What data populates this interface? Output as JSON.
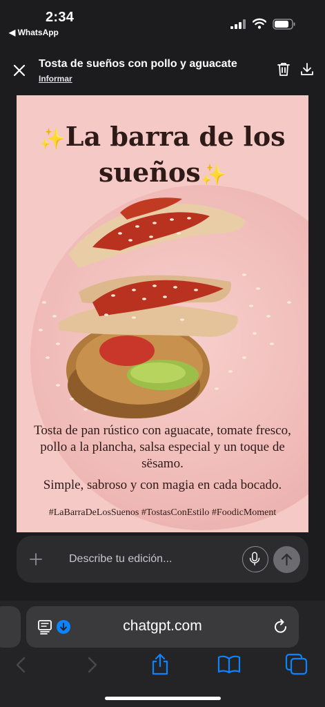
{
  "status_bar": {
    "time": "2:34",
    "back_app": "◀ WhatsApp"
  },
  "header": {
    "title": "Tosta de sueños con pollo y aguacate",
    "report_link": "Informar"
  },
  "poster": {
    "title_line1": "La barra de los",
    "title_line2": "sueños",
    "description": "Tosta de pan rústico con aguacate, tomate fresco, pollo a la plancha, salsa especial y un toque de sësamo.",
    "tagline": "Simple, sabroso y con magia en cada bocado.",
    "hashtags": "#LaBarraDeLosSuenos #TostasConEstilo #FoodicMoment",
    "sparkle": "✨"
  },
  "composer": {
    "placeholder": "Describe tu edición..."
  },
  "browser": {
    "url": "chatgpt.com"
  },
  "colors": {
    "poster_bg": "#f4c9c6",
    "accent": "#0a84ff",
    "text_dark": "#2e1b17"
  },
  "icons": [
    "close-icon",
    "trash-icon",
    "download-icon",
    "plus-icon",
    "mic-icon",
    "arrow-up-icon",
    "reader-icon",
    "reload-icon",
    "chevron-left-icon",
    "chevron-right-icon",
    "share-icon",
    "book-icon",
    "tabs-icon"
  ]
}
